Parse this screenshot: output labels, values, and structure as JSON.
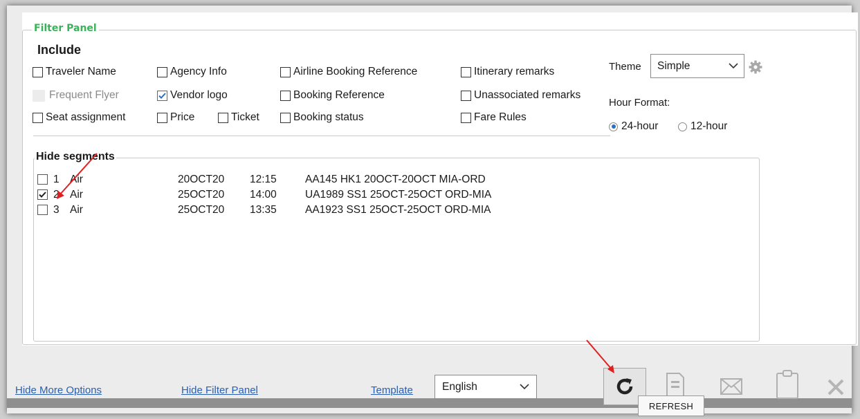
{
  "filter_panel": {
    "legend": "Filter Panel",
    "include_title": "Include",
    "include_options": [
      {
        "label": "Traveler Name",
        "checked": false,
        "disabled": false
      },
      {
        "label": "Agency Info",
        "checked": false,
        "disabled": false
      },
      {
        "label": "Airline Booking Reference",
        "checked": false,
        "disabled": false
      },
      {
        "label": "Itinerary remarks",
        "checked": false,
        "disabled": false
      },
      {
        "label": "Frequent Flyer",
        "checked": false,
        "disabled": true
      },
      {
        "label": "Vendor logo",
        "checked": true,
        "disabled": false
      },
      {
        "label": "Booking Reference",
        "checked": false,
        "disabled": false
      },
      {
        "label": "Unassociated remarks",
        "checked": false,
        "disabled": false
      },
      {
        "label": "Seat assignment",
        "checked": false,
        "disabled": false
      },
      {
        "label": "Price",
        "checked": false,
        "disabled": false
      },
      {
        "label": "Ticket",
        "checked": false,
        "disabled": false
      },
      {
        "label": "Booking status",
        "checked": false,
        "disabled": false
      },
      {
        "label": "Fare Rules",
        "checked": false,
        "disabled": false
      }
    ],
    "theme": {
      "label": "Theme",
      "value": "Simple"
    },
    "hour_format": {
      "label": "Hour Format:",
      "options": [
        "24-hour",
        "12-hour"
      ],
      "selected": "24-hour"
    }
  },
  "hide_segments": {
    "title": "Hide segments",
    "rows": [
      {
        "num": "1",
        "type": "Air",
        "date": "20OCT20",
        "time": "12:15",
        "desc": "AA145 HK1 20OCT-20OCT MIA-ORD",
        "checked": false
      },
      {
        "num": "2",
        "type": "Air",
        "date": "25OCT20",
        "time": "14:00",
        "desc": "UA1989 SS1 25OCT-25OCT ORD-MIA",
        "checked": true
      },
      {
        "num": "3",
        "type": "Air",
        "date": "25OCT20",
        "time": "13:35",
        "desc": "AA1923 SS1 25OCT-25OCT ORD-MIA",
        "checked": false
      }
    ]
  },
  "bottom_bar": {
    "hide_more_options": "Hide More Options",
    "hide_filter_panel": "Hide Filter Panel",
    "template_link": "Template",
    "language": "English",
    "tooltip": "REFRESH"
  },
  "colors": {
    "accent_green": "#3cb05a",
    "link_blue": "#2a5fb0",
    "arrow_red": "#e02020",
    "check_blue": "#2f6fbf"
  },
  "icons": [
    "gear-icon",
    "refresh-icon",
    "document-icon",
    "email-icon",
    "clipboard-icon",
    "close-icon",
    "chevron-down-icon"
  ]
}
